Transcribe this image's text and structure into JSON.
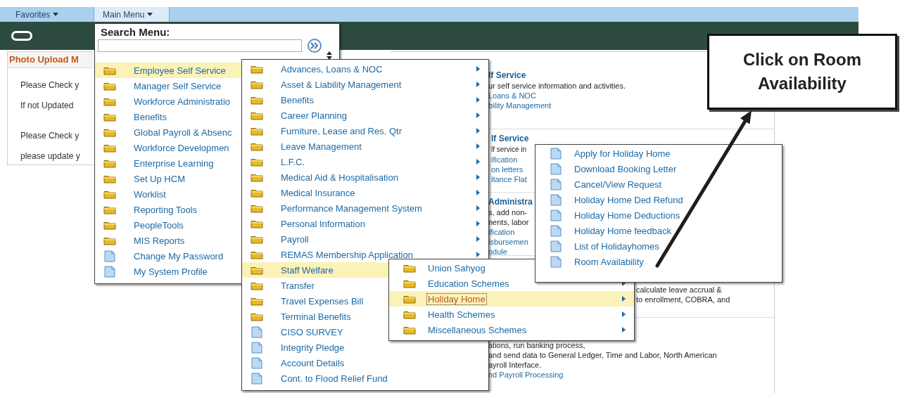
{
  "top_bar": {
    "tabs": [
      {
        "label": "Favorites",
        "selected": false
      },
      {
        "label": "Main Menu",
        "selected": true
      }
    ]
  },
  "photo_pagelet": {
    "title": "Photo Upload M",
    "paragraphs": [
      [
        "Please Check y",
        "If not Updated"
      ],
      [
        "Please Check y",
        "please update y"
      ]
    ]
  },
  "main_pagelet": {
    "sections": [
      {
        "heading": "lf Service",
        "lines": [
          {
            "text": "ur self service information and activities.",
            "kind": "desc"
          },
          {
            "text": "Loans & NOC",
            "kind": "link"
          },
          {
            "text": "bility Management",
            "kind": "link"
          }
        ]
      },
      {
        "heading": "lf Service",
        "lines": [
          {
            "text": "lf service in",
            "kind": "desc"
          },
          {
            "text": "ification",
            "kind": "link"
          },
          {
            "text": "on letters",
            "kind": "link"
          },
          {
            "text": "itance Flat",
            "kind": "link"
          }
        ]
      },
      {
        "heading": "Administra",
        "lines": [
          {
            "text": "s, add non-",
            "kind": "desc"
          },
          {
            "text": "nents, labor",
            "kind": "desc"
          },
          {
            "text": "ification",
            "kind": "link"
          },
          {
            "text": "isbursemen",
            "kind": "link"
          },
          {
            "text": "odule",
            "kind": "link"
          }
        ]
      },
      {
        "lines": [
          {
            "text": "calculate leave accrual &",
            "kind": "desc"
          },
          {
            "text": "to enrollment, COBRA, and",
            "kind": "desc"
          }
        ]
      },
      {
        "lines": [
          {
            "text": "ations, run banking process,",
            "kind": "desc"
          },
          {
            "text": "and send data to General Ledger, Time and Labor, North American",
            "kind": "desc"
          },
          {
            "text": "ayroll Interface.",
            "kind": "desc"
          },
          {
            "text": "nd Payroll Processing",
            "kind": "link"
          }
        ]
      }
    ]
  },
  "menus": [
    {
      "search": {
        "label": "Search Menu:"
      },
      "arrows": false,
      "items": [
        {
          "label": "Employee Self Service",
          "kind": "folder",
          "selected": true
        },
        {
          "label": "Manager Self Service",
          "kind": "folder",
          "selected": false
        },
        {
          "label": "Workforce Administratio",
          "kind": "folder",
          "selected": false
        },
        {
          "label": "Benefits",
          "kind": "folder",
          "selected": false
        },
        {
          "label": "Global Payroll & Absenc",
          "kind": "folder",
          "selected": false
        },
        {
          "label": "Workforce Developmen",
          "kind": "folder",
          "selected": false
        },
        {
          "label": "Enterprise Learning",
          "kind": "folder",
          "selected": false
        },
        {
          "label": "Set Up HCM",
          "kind": "folder",
          "selected": false
        },
        {
          "label": "Worklist",
          "kind": "folder",
          "selected": false
        },
        {
          "label": "Reporting Tools",
          "kind": "folder",
          "selected": false
        },
        {
          "label": "PeopleTools",
          "kind": "folder",
          "selected": false
        },
        {
          "label": "MIS Reports",
          "kind": "folder",
          "selected": false
        },
        {
          "label": "Change My Password",
          "kind": "page",
          "selected": false
        },
        {
          "label": "My System Profile",
          "kind": "page",
          "selected": false
        }
      ]
    },
    {
      "arrows": true,
      "items": [
        {
          "label": "Advances, Loans & NOC",
          "kind": "folder",
          "selected": false
        },
        {
          "label": "Asset & Liability Management",
          "kind": "folder",
          "selected": false
        },
        {
          "label": "Benefits",
          "kind": "folder",
          "selected": false
        },
        {
          "label": "Career Planning",
          "kind": "folder",
          "selected": false
        },
        {
          "label": "Furniture, Lease and Res. Qtr",
          "kind": "folder",
          "selected": false
        },
        {
          "label": "Leave Management",
          "kind": "folder",
          "selected": false
        },
        {
          "label": "L.F.C.",
          "kind": "folder",
          "selected": false
        },
        {
          "label": "Medical Aid & Hospitalisation",
          "kind": "folder",
          "selected": false
        },
        {
          "label": "Medical Insurance",
          "kind": "folder",
          "selected": false
        },
        {
          "label": "Performance Management System",
          "kind": "folder",
          "selected": false
        },
        {
          "label": "Personal Information",
          "kind": "folder",
          "selected": false
        },
        {
          "label": "Payroll",
          "kind": "folder",
          "selected": false
        },
        {
          "label": "REMAS Membership Application",
          "kind": "folder",
          "selected": false
        },
        {
          "label": "Staff Welfare",
          "kind": "folder",
          "selected": true
        },
        {
          "label": "Transfer",
          "kind": "folder",
          "selected": false
        },
        {
          "label": "Travel Expenses Bill",
          "kind": "folder",
          "selected": false
        },
        {
          "label": "Terminal Benefits",
          "kind": "folder",
          "selected": false
        },
        {
          "label": "CISO SURVEY",
          "kind": "page",
          "selected": false
        },
        {
          "label": "Integrity Pledge",
          "kind": "page",
          "selected": false
        },
        {
          "label": "Account Details",
          "kind": "page",
          "selected": false
        },
        {
          "label": "Cont. to Flood Relief Fund",
          "kind": "page",
          "selected": false
        }
      ]
    },
    {
      "arrows": true,
      "items": [
        {
          "label": "Union Sahyog",
          "kind": "folder",
          "selected": false,
          "focused": false
        },
        {
          "label": "Education Schemes",
          "kind": "folder",
          "selected": false,
          "focused": false
        },
        {
          "label": "Holiday Home",
          "kind": "folder",
          "selected": true,
          "focused": true
        },
        {
          "label": "Health Schemes",
          "kind": "folder",
          "selected": false,
          "focused": false
        },
        {
          "label": "Miscellaneous Schemes",
          "kind": "folder",
          "selected": false,
          "focused": false
        }
      ]
    },
    {
      "items": [
        {
          "label": "Apply for Holiday Home",
          "kind": "page",
          "selected": false
        },
        {
          "label": "Download Booking Letter",
          "kind": "page",
          "selected": false
        },
        {
          "label": "Cancel/View Request",
          "kind": "page",
          "selected": false
        },
        {
          "label": "Holiday Home Ded Refund",
          "kind": "page",
          "selected": false
        },
        {
          "label": "Holiday Home Deductions",
          "kind": "page",
          "selected": false
        },
        {
          "label": "Holiday Home feedback",
          "kind": "page",
          "selected": false
        },
        {
          "label": "List of Holidayhomes",
          "kind": "page",
          "selected": false
        },
        {
          "label": "Room Availability",
          "kind": "page",
          "selected": false
        }
      ]
    }
  ],
  "callout": {
    "text": "Click on Room Availability"
  }
}
